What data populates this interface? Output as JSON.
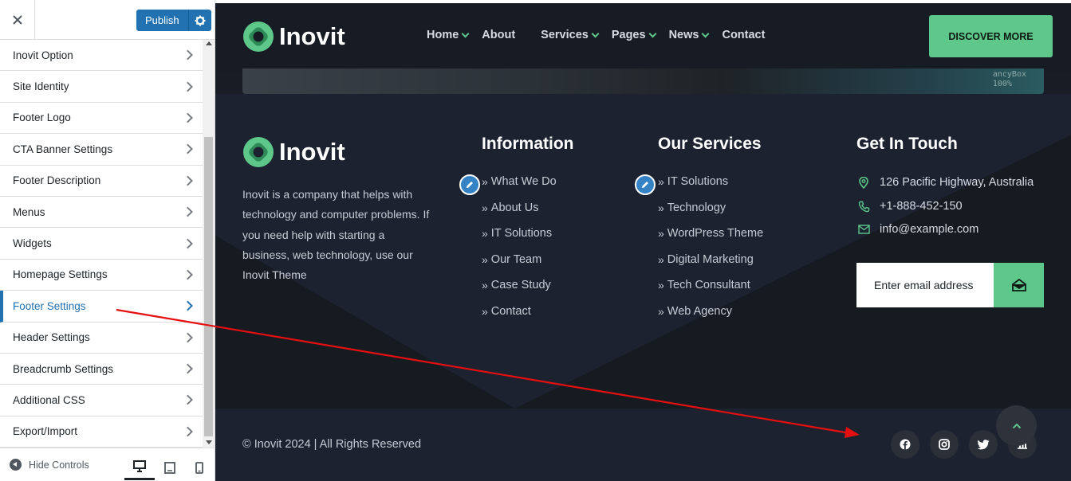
{
  "customizer": {
    "publish_label": "Publish",
    "menu": [
      {
        "label": "Inovit Option"
      },
      {
        "label": "Site Identity"
      },
      {
        "label": "Footer Logo"
      },
      {
        "label": "CTA Banner Settings"
      },
      {
        "label": "Footer Description"
      },
      {
        "label": "Menus"
      },
      {
        "label": "Widgets"
      },
      {
        "label": "Homepage Settings"
      },
      {
        "label": "Footer Settings",
        "active": true
      },
      {
        "label": "Header Settings"
      },
      {
        "label": "Breadcrumb Settings"
      },
      {
        "label": "Additional CSS"
      },
      {
        "label": "Export/Import"
      }
    ],
    "hide_controls_label": "Hide Controls",
    "accent_color": "#2271b1"
  },
  "site": {
    "brand": "Inovit",
    "accent_color": "#5dc88a",
    "nav": [
      {
        "label": "Home",
        "dropdown": true
      },
      {
        "label": "About",
        "dropdown": false
      },
      {
        "label": "Services",
        "dropdown": true
      },
      {
        "label": "Pages",
        "dropdown": true
      },
      {
        "label": "News",
        "dropdown": true
      },
      {
        "label": "Contact",
        "dropdown": false
      }
    ],
    "cta_button": "DISCOVER MORE",
    "banner_code": "ancyBox\n100%",
    "footer": {
      "brand": "Inovit",
      "description": "Inovit is a company that helps with technology and computer problems. If you need help with starting a business, web technology, use our Inovit Theme",
      "information": {
        "title": "Information",
        "links": [
          "What We Do",
          "About Us",
          "IT Solutions",
          "Our Team",
          "Case Study",
          "Contact"
        ]
      },
      "services": {
        "title": "Our Services",
        "links": [
          "IT Solutions",
          "Technology",
          "WordPress Theme",
          "Digital Marketing",
          "Tech Consultant",
          "Web Agency"
        ]
      },
      "contact": {
        "title": "Get In Touch",
        "address": "126 Pacific Highway, Australia",
        "phone": "+1-888-452-150",
        "email": "info@example.com"
      },
      "newsletter_placeholder": "Enter email address",
      "copyright": "© Inovit 2024 | All Rights Reserved",
      "social": [
        "facebook-icon",
        "instagram-icon",
        "twitter-icon",
        "chart-icon"
      ]
    }
  }
}
